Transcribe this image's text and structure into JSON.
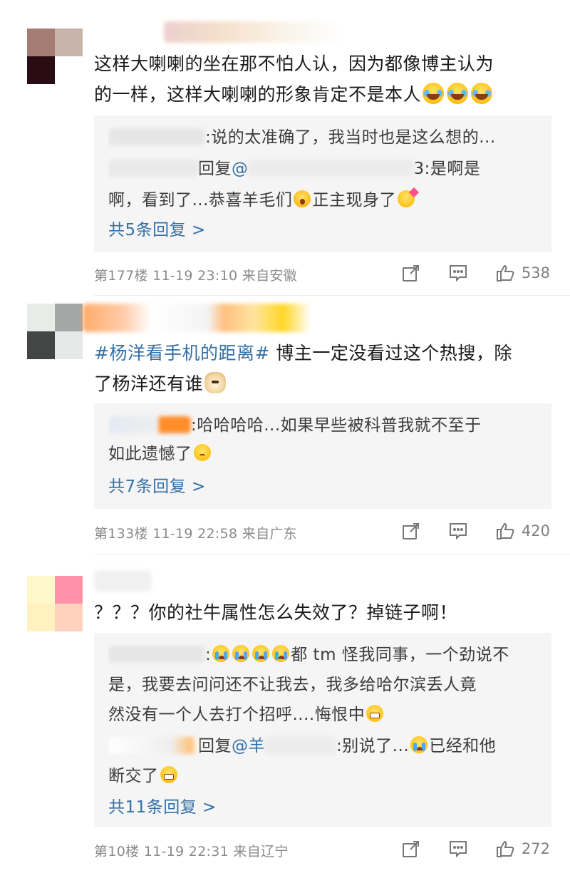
{
  "colors": {
    "link": "#3470a8",
    "meta": "#8a8a8a",
    "reply_bg": "#f5f5f5",
    "text": "#1a1a1a"
  },
  "comments": [
    {
      "body_parts": [
        "这样大喇喇的坐在那不怕人认，因为都像博主认为",
        "的一样，这样大喇喇的形象肯定不是本人"
      ],
      "replies": [
        {
          "text": ":说的太准确了，我当时也是这么想的..."
        },
        {
          "prefix": "回复",
          "at": "@",
          "suffix": "3:是啊是",
          "line2_a": "啊，看到了...恭喜羊毛们",
          "line2_b": "正主现身了"
        }
      ],
      "more": "共5条回复 >",
      "floor": "第177楼",
      "time": "11-19 23:10",
      "location": "来自安徽",
      "likes": "538"
    },
    {
      "topic": "#杨洋看手机的距离#",
      "body_a": " 博主一定没看过这个热搜，除",
      "body_b": "了杨洋还有谁",
      "replies": [
        {
          "text": ":哈哈哈哈...如果早些被科普我就不至于",
          "line2": "如此遗憾了"
        }
      ],
      "more": "共7条回复 >",
      "floor": "第133楼",
      "time": "11-19 22:58",
      "location": "来自广东",
      "likes": "420"
    },
    {
      "body": "？？？你的社牛属性怎么失效了？掉链子啊！",
      "replies": [
        {
          "lead": ":",
          "text_a": "都 tm 怪我同事，一个劲说不",
          "line2": "是，我要去问问还不让我去，我多给哈尔滨丢人竟",
          "line3": "然没有一个人去打个招呼....悔恨中"
        },
        {
          "prefix": "回复",
          "at": "@羊",
          "suffix": ":别说了...",
          "suffix2": "已经和他",
          "line2": "断交了"
        }
      ],
      "more": "共11条回复 >",
      "floor": "第10楼",
      "time": "11-19 22:31",
      "location": "来自辽宁",
      "likes": "272"
    }
  ],
  "icons": [
    "share-icon",
    "comment-icon",
    "like-icon"
  ]
}
